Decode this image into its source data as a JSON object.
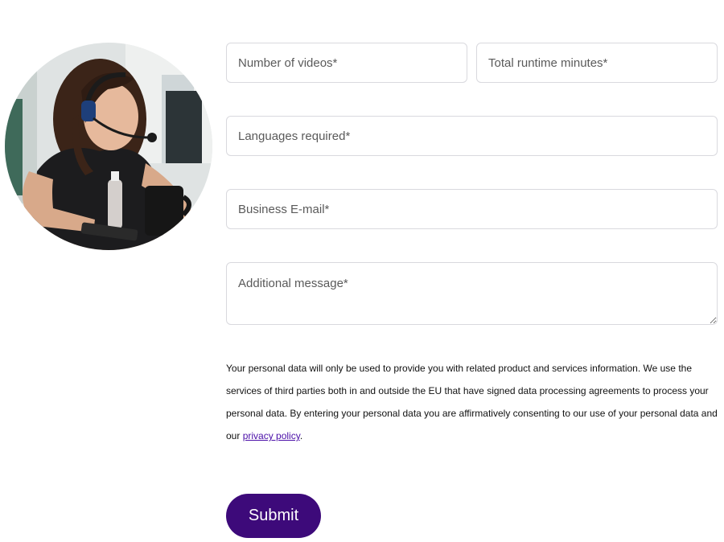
{
  "form": {
    "num_videos_placeholder": "Number of videos*",
    "runtime_placeholder": "Total runtime minutes*",
    "languages_placeholder": "Languages required*",
    "email_placeholder": "Business E-mail*",
    "message_placeholder": "Additional message*"
  },
  "privacy": {
    "text_before": "Your personal data will only be used to provide you with related product and services information. We use the services of third parties both in and outside the EU that have signed data processing agreements to process your personal data. By entering your personal data you are affirmatively consenting to our use of your personal data and our ",
    "link_label": "privacy policy",
    "text_after": "."
  },
  "submit_label": "Submit",
  "colors": {
    "accent": "#3d0a7a",
    "link": "#4a0ea8",
    "border": "#d9d9de"
  }
}
